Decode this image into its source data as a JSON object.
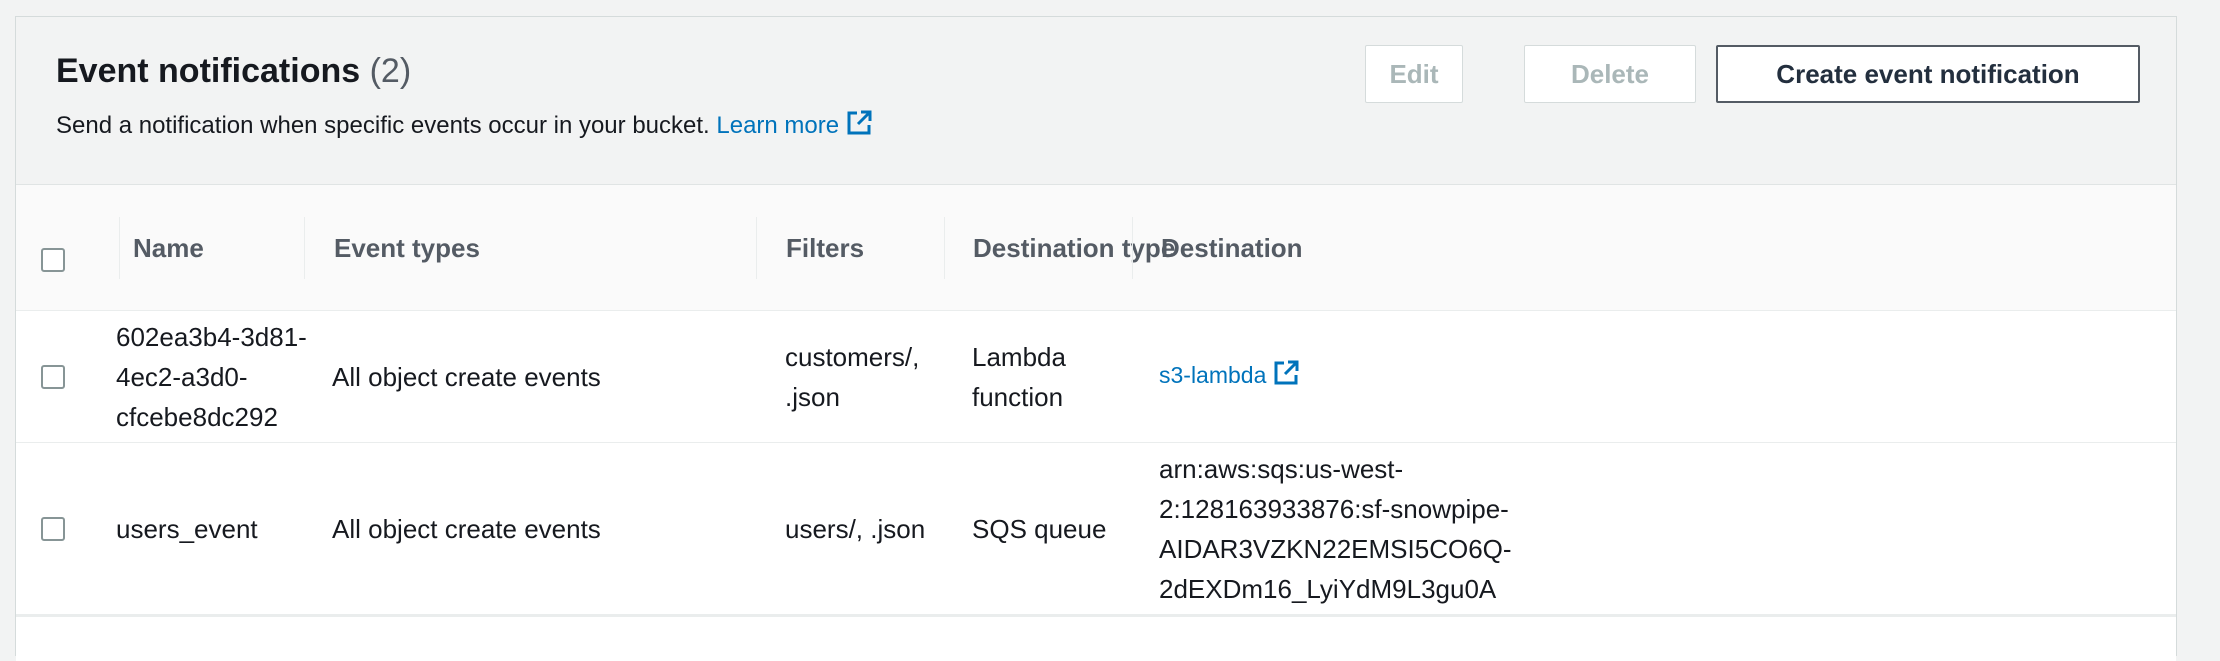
{
  "header": {
    "title": "Event notifications",
    "count": "(2)",
    "description": "Send a notification when specific events occur in your bucket.",
    "learn_more": "Learn more",
    "buttons": {
      "edit": "Edit",
      "delete": "Delete",
      "create": "Create event notification"
    }
  },
  "table": {
    "columns": {
      "name": "Name",
      "event_types": "Event types",
      "filters": "Filters",
      "destination_type_line1": "Destination",
      "destination_type_line2": "type",
      "destination": "Destination"
    },
    "rows": [
      {
        "name_lines": [
          "602ea3b4-3d81-",
          "4ec2-a3d0-",
          "cfcebe8dc292"
        ],
        "event_types": "All object create events",
        "filters_lines": [
          "customers/,",
          ".json"
        ],
        "destination_type_lines": [
          "Lambda",
          "function"
        ],
        "destination": "s3-lambda"
      },
      {
        "name": "users_event",
        "event_types": "All object create events",
        "filters": "users/, .json",
        "destination_type": "SQS queue",
        "destination_lines": [
          "arn:aws:sqs:us-west-",
          "2:128163933876:sf-snowpipe-",
          "AIDAR3VZKN22EMSI5CO6Q-",
          "2dEXDm16_LyiYdM9L3gu0A"
        ]
      }
    ]
  },
  "colors": {
    "link": "#0073bb",
    "header_bg": "#f2f3f3",
    "disabled_text": "#aab7b8"
  }
}
